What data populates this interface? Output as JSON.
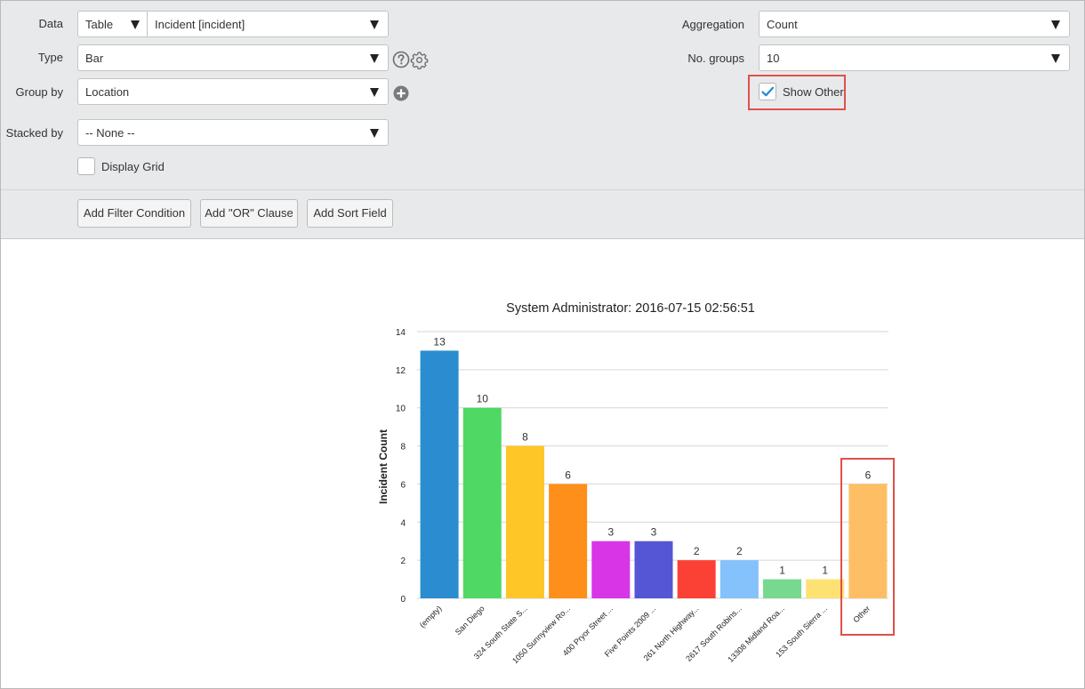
{
  "form": {
    "data": {
      "label": "Data",
      "source": "Table",
      "table": "Incident [incident]"
    },
    "type": {
      "label": "Type",
      "value": "Bar"
    },
    "group_by": {
      "label": "Group by",
      "value": "Location"
    },
    "stacked_by": {
      "label": "Stacked by",
      "value": "-- None --"
    },
    "display_grid": {
      "label": "Display Grid",
      "checked": false
    },
    "aggregation": {
      "label": "Aggregation",
      "value": "Count"
    },
    "no_groups": {
      "label": "No. groups",
      "value": "10"
    },
    "show_other": {
      "label": "Show Other",
      "checked": true
    }
  },
  "filter_bar": {
    "add_filter": "Add Filter Condition",
    "add_or": "Add \"OR\" Clause",
    "add_sort": "Add Sort Field"
  },
  "icons": [
    "help-icon",
    "gear-icon",
    "add-icon",
    "checkmark-icon",
    "dropdown-arrow-icon"
  ],
  "colors": {
    "highlight": "#e0504a",
    "check": "#1f8ad1"
  },
  "chart_data": {
    "type": "bar",
    "title": "System Administrator: 2016-07-15 02:56:51",
    "xlabel": "",
    "ylabel": "Incident Count",
    "ylim": [
      0,
      14
    ],
    "yticks": [
      0,
      2,
      4,
      6,
      8,
      10,
      12,
      14
    ],
    "grid": true,
    "categories": [
      "(empty)",
      "San Diego",
      "324 South State S...",
      "1050 Sunnyview Ro...",
      "400 Pryor Street ...",
      "Five Points 2009 ...",
      "261 North Highway...",
      "2617 South Robins...",
      "13308 Midland Roa...",
      "153 South Sierra ...",
      "Other"
    ],
    "values": [
      13,
      10,
      8,
      6,
      3,
      3,
      2,
      2,
      1,
      1,
      6
    ],
    "colors": [
      "#2b8ccf",
      "#4fd863",
      "#fec626",
      "#fd8f1a",
      "#d835e6",
      "#5456d6",
      "#fb4135",
      "#85c1fb",
      "#76d98f",
      "#fde172",
      "#febf64"
    ]
  }
}
